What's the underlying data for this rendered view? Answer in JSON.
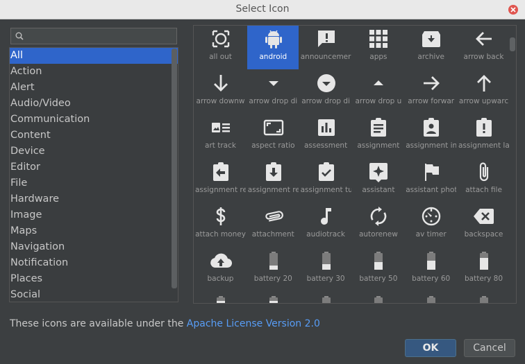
{
  "window": {
    "title": "Select Icon"
  },
  "search": {
    "value": "",
    "placeholder": ""
  },
  "categories": [
    "All",
    "Action",
    "Alert",
    "Audio/Video",
    "Communication",
    "Content",
    "Device",
    "Editor",
    "File",
    "Hardware",
    "Image",
    "Maps",
    "Navigation",
    "Notification",
    "Places",
    "Social"
  ],
  "selected_category": "All",
  "icons": [
    {
      "label": "all out",
      "name": "all-out-icon"
    },
    {
      "label": "android",
      "name": "android-icon"
    },
    {
      "label": "announcemer",
      "name": "announcement-icon"
    },
    {
      "label": "apps",
      "name": "apps-icon"
    },
    {
      "label": "archive",
      "name": "archive-icon"
    },
    {
      "label": "arrow back",
      "name": "arrow-back-icon"
    },
    {
      "label": "arrow downw",
      "name": "arrow-downward-icon"
    },
    {
      "label": "arrow drop di",
      "name": "arrow-drop-down-icon"
    },
    {
      "label": "arrow drop di",
      "name": "arrow-drop-down-circle-icon"
    },
    {
      "label": "arrow drop u",
      "name": "arrow-drop-up-icon"
    },
    {
      "label": "arrow forwar",
      "name": "arrow-forward-icon"
    },
    {
      "label": "arrow upwarc",
      "name": "arrow-upward-icon"
    },
    {
      "label": "art track",
      "name": "art-track-icon"
    },
    {
      "label": "aspect ratio",
      "name": "aspect-ratio-icon"
    },
    {
      "label": "assessment",
      "name": "assessment-icon"
    },
    {
      "label": "assignment",
      "name": "assignment-icon"
    },
    {
      "label": "assignment in",
      "name": "assignment-ind-icon"
    },
    {
      "label": "assignment la",
      "name": "assignment-late-icon"
    },
    {
      "label": "assignment re",
      "name": "assignment-return-icon"
    },
    {
      "label": "assignment re",
      "name": "assignment-returned-icon"
    },
    {
      "label": "assignment tu",
      "name": "assignment-turned-in-icon"
    },
    {
      "label": "assistant",
      "name": "assistant-icon"
    },
    {
      "label": "assistant phot",
      "name": "assistant-photo-icon"
    },
    {
      "label": "attach file",
      "name": "attach-file-icon"
    },
    {
      "label": "attach money",
      "name": "attach-money-icon"
    },
    {
      "label": "attachment",
      "name": "attachment-icon"
    },
    {
      "label": "audiotrack",
      "name": "audiotrack-icon"
    },
    {
      "label": "autorenew",
      "name": "autorenew-icon"
    },
    {
      "label": "av timer",
      "name": "av-timer-icon"
    },
    {
      "label": "backspace",
      "name": "backspace-icon"
    },
    {
      "label": "backup",
      "name": "backup-icon"
    },
    {
      "label": "battery 20",
      "name": "battery-20-icon"
    },
    {
      "label": "battery 30",
      "name": "battery-30-icon"
    },
    {
      "label": "battery 50",
      "name": "battery-50-icon"
    },
    {
      "label": "battery 60",
      "name": "battery-60-icon"
    },
    {
      "label": "battery 80",
      "name": "battery-80-icon"
    },
    {
      "label": "",
      "name": "battery-90-icon"
    },
    {
      "label": "",
      "name": "battery-alert-icon"
    },
    {
      "label": "",
      "name": "battery-charging-20-icon"
    },
    {
      "label": "",
      "name": "battery-charging-30-icon"
    },
    {
      "label": "",
      "name": "battery-charging-50-icon"
    },
    {
      "label": "",
      "name": "battery-charging-60-icon"
    }
  ],
  "selected_icon": "android",
  "license": {
    "text": "These icons are available under the ",
    "link": "Apache License Version 2.0"
  },
  "buttons": {
    "ok": "OK",
    "cancel": "Cancel"
  }
}
